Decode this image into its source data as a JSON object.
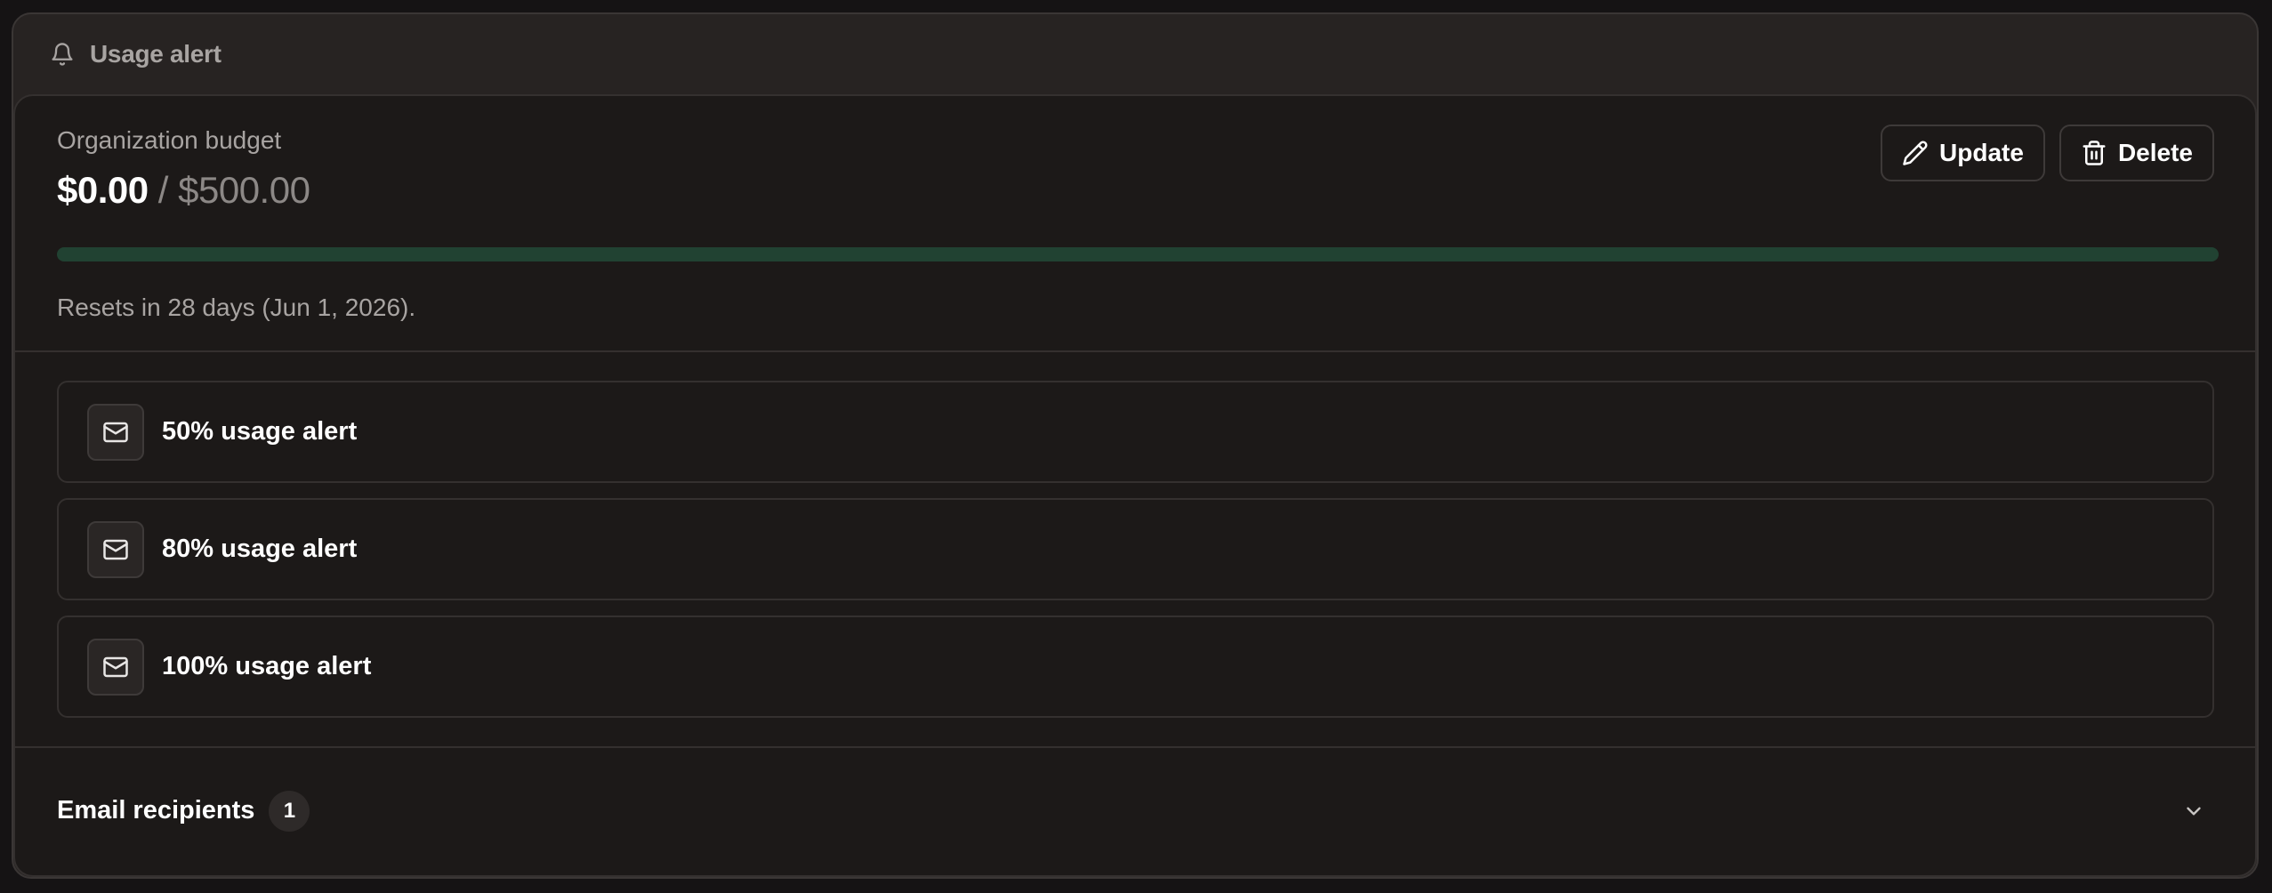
{
  "header": {
    "title": "Usage alert",
    "icon": "bell-icon"
  },
  "budget": {
    "label": "Organization budget",
    "spent": "$0.00",
    "separator": " / ",
    "total": "$500.00",
    "progress_fraction": 0.0,
    "reset_text": "Resets in 28 days (Jun 1, 2026).",
    "track_color": "#214232",
    "fill_color": "#3fb27f"
  },
  "actions": {
    "update_label": "Update",
    "update_icon": "pencil-icon",
    "delete_label": "Delete",
    "delete_icon": "trash-icon"
  },
  "alerts": [
    {
      "label": "50% usage alert",
      "icon": "mail-icon"
    },
    {
      "label": "80% usage alert",
      "icon": "mail-icon"
    },
    {
      "label": "100% usage alert",
      "icon": "mail-icon"
    }
  ],
  "recipients": {
    "label": "Email recipients",
    "count": "1",
    "icon": "chevron-down-icon"
  }
}
